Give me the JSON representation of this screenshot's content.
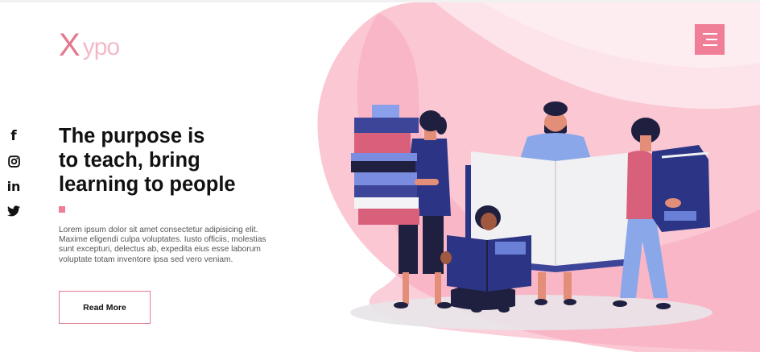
{
  "brand": {
    "logo_x": "X",
    "logo_rest": "ypo"
  },
  "social": {
    "facebook": "f",
    "linkedin": "in"
  },
  "hero": {
    "title_lines": [
      "The purpose is",
      "to teach, bring",
      "learning to people"
    ],
    "description": "Lorem ipsum dolor sit amet consectetur adipisicing elit. Maxime eligendi culpa voluptates. Iusto officiis, molestias sunt excepturi, delectus ab, expedita eius esse laborum voluptate totam inventore ipsa sed vero veniam.",
    "cta_label": "Read More"
  },
  "icons": [
    "menu-icon",
    "facebook-icon",
    "instagram-icon",
    "linkedin-icon",
    "twitter-icon"
  ],
  "colors": {
    "accent": "#f07e97",
    "logo": "#e2798f",
    "logo_light": "#f3b9c7",
    "blob_light": "#fde3ea",
    "blob": "#f9b7c8",
    "book_navy": "#2c3585"
  }
}
